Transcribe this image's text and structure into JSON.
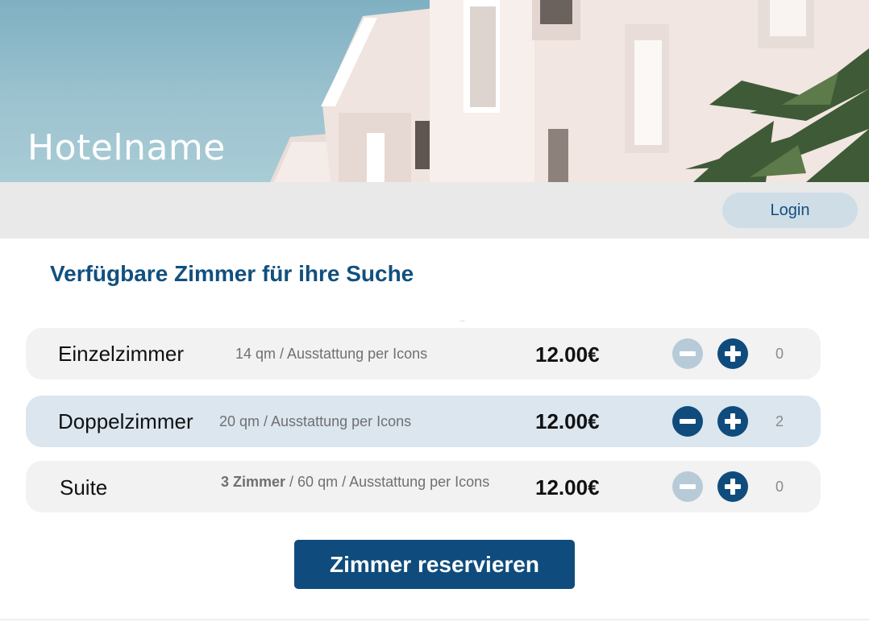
{
  "hero": {
    "hotel_name": "Hotelname"
  },
  "header": {
    "login_label": "Login"
  },
  "main": {
    "heading": "Verfügbare Zimmer für ihre Suche",
    "ellipsis": "...",
    "rooms": [
      {
        "name": "Einzelzimmer",
        "desc_bold": "",
        "desc": "14 qm / Ausstattung per Icons",
        "price": "12.00€",
        "quantity": "0",
        "selected": false
      },
      {
        "name": "Doppelzimmer",
        "desc_bold": "",
        "desc": "20 qm / Ausstattung per Icons",
        "price": "12.00€",
        "quantity": "2",
        "selected": true
      },
      {
        "name": "Suite",
        "desc_bold": "3 Zimmer",
        "desc": " / 60 qm / Ausstattung per Icons",
        "price": "12.00€",
        "quantity": "0",
        "selected": false
      }
    ],
    "reserve_label": "Zimmer reservieren"
  },
  "colors": {
    "primary": "#0f4c7d",
    "login_bg": "#cfdde7",
    "row_bg": "#f2f2f3",
    "row_active_bg": "#dbe6ef",
    "disabled_control": "#b7cad8"
  },
  "icons": {
    "decrement": "minus-icon",
    "increment": "plus-icon"
  }
}
